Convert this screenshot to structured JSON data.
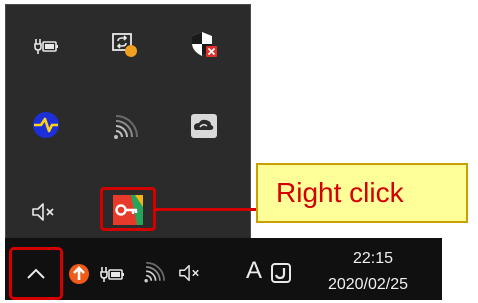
{
  "callout": {
    "label": "Right click"
  },
  "taskbar": {
    "ime_indicator": "A",
    "clock_time": "22:15",
    "clock_date": "2020/02/25"
  },
  "tray_overflow": {
    "icons": [
      "battery-charging-icon",
      "remote-desktop-update-icon",
      "security-shield-alert-icon",
      "network-adapter-icon",
      "wifi-icon",
      "cloud-sync-icon",
      "volume-muted-icon",
      "vpn-key-app-icon"
    ]
  },
  "colors": {
    "panel_bg": "#2b2b2b",
    "taskbar_bg": "#101010",
    "highlight": "#d40000",
    "callout_bg": "#ffff99",
    "callout_text": "#d40000"
  }
}
